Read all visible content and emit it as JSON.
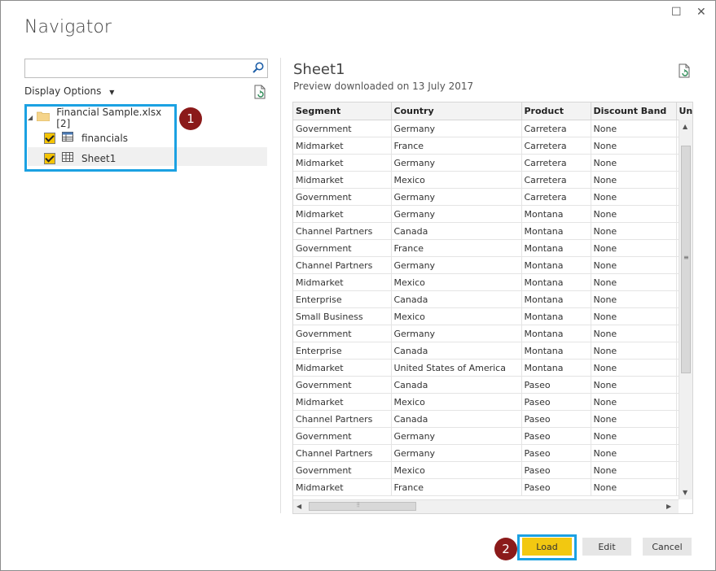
{
  "window": {
    "title": "Navigator",
    "maximize_glyph": "☐",
    "close_glyph": "✕"
  },
  "left": {
    "search_placeholder": "",
    "display_options_label": "Display Options",
    "tree": {
      "root_label": "Financial Sample.xlsx [2]",
      "items": [
        {
          "label": "financials",
          "icon": "table-icon",
          "checked": true
        },
        {
          "label": "Sheet1",
          "icon": "sheet-icon",
          "checked": true
        }
      ]
    },
    "marker_1": "1"
  },
  "preview": {
    "title": "Sheet1",
    "subtitle": "Preview downloaded on 13 July 2017",
    "columns": [
      "Segment",
      "Country",
      "Product",
      "Discount Band",
      "Uni"
    ],
    "rows": [
      [
        "Government",
        "Germany",
        "Carretera",
        "None"
      ],
      [
        "Midmarket",
        "France",
        "Carretera",
        "None"
      ],
      [
        "Midmarket",
        "Germany",
        "Carretera",
        "None"
      ],
      [
        "Midmarket",
        "Mexico",
        "Carretera",
        "None"
      ],
      [
        "Government",
        "Germany",
        "Carretera",
        "None"
      ],
      [
        "Midmarket",
        "Germany",
        "Montana",
        "None"
      ],
      [
        "Channel Partners",
        "Canada",
        "Montana",
        "None"
      ],
      [
        "Government",
        "France",
        "Montana",
        "None"
      ],
      [
        "Channel Partners",
        "Germany",
        "Montana",
        "None"
      ],
      [
        "Midmarket",
        "Mexico",
        "Montana",
        "None"
      ],
      [
        "Enterprise",
        "Canada",
        "Montana",
        "None"
      ],
      [
        "Small Business",
        "Mexico",
        "Montana",
        "None"
      ],
      [
        "Government",
        "Germany",
        "Montana",
        "None"
      ],
      [
        "Enterprise",
        "Canada",
        "Montana",
        "None"
      ],
      [
        "Midmarket",
        "United States of America",
        "Montana",
        "None"
      ],
      [
        "Government",
        "Canada",
        "Paseo",
        "None"
      ],
      [
        "Midmarket",
        "Mexico",
        "Paseo",
        "None"
      ],
      [
        "Channel Partners",
        "Canada",
        "Paseo",
        "None"
      ],
      [
        "Government",
        "Germany",
        "Paseo",
        "None"
      ],
      [
        "Channel Partners",
        "Germany",
        "Paseo",
        "None"
      ],
      [
        "Government",
        "Mexico",
        "Paseo",
        "None"
      ],
      [
        "Midmarket",
        "France",
        "Paseo",
        "None"
      ]
    ]
  },
  "footer": {
    "marker_2": "2",
    "load_label": "Load",
    "edit_label": "Edit",
    "cancel_label": "Cancel"
  },
  "colors": {
    "accent_highlight": "#1ba1e2",
    "load_button": "#f2c811",
    "marker": "#8b1a1a",
    "checkbox": "#f5c400"
  }
}
